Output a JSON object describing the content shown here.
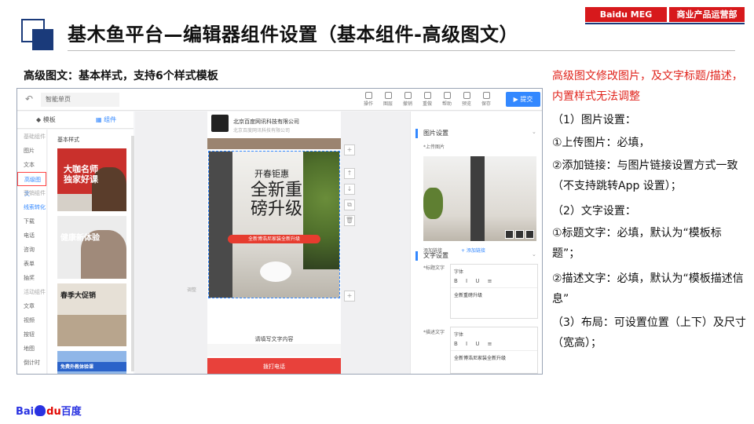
{
  "slide": {
    "title": "基木鱼平台—编辑器组件设置（基本组件-高级图文）",
    "badge_left": "Baidu MEG",
    "badge_right": "商业产品运营部",
    "subtitle": "高级图文：基本样式，支持6个样式模板",
    "logo_text_bai": "Bai",
    "logo_text_du": "du",
    "logo_text_cn": "百度"
  },
  "notes": {
    "red": "高级图文修改图片，及文字标题/描述，内置样式无法调整",
    "lines": [
      "（1）图片设置：",
      "①上传图片：必填，",
      "②添加链接：与图片链接设置方式一致（不支持跳转App 设置）；",
      "（2）文字设置：",
      "①标题文字：必填，默认为“模板标题”；",
      "②描述文字：必填，默认为“模板描述信息”",
      "（3）布局：可设置位置（上下）及尺寸（宽高）；"
    ]
  },
  "editor": {
    "page_name": "智能单页",
    "toolbar": [
      "操作",
      "图层",
      "撤销",
      "重做",
      "帮助",
      "预览",
      "保存"
    ],
    "submit": "提交",
    "tabs": {
      "template": "模板",
      "component": "组件"
    },
    "categories": [
      {
        "label": "基础组件",
        "kind": "head"
      },
      {
        "label": "图片",
        "kind": "item"
      },
      {
        "label": "文本",
        "kind": "item"
      },
      {
        "label": "高级图文",
        "kind": "active"
      },
      {
        "label": "营销组件",
        "kind": "head"
      },
      {
        "label": "线索转化",
        "kind": "blue"
      },
      {
        "label": "下载",
        "kind": "item"
      },
      {
        "label": "电话",
        "kind": "item"
      },
      {
        "label": "咨询",
        "kind": "item"
      },
      {
        "label": "表单",
        "kind": "item"
      },
      {
        "label": "抽奖",
        "kind": "item"
      },
      {
        "label": "活动组件",
        "kind": "head"
      },
      {
        "label": "文章",
        "kind": "item"
      },
      {
        "label": "视频",
        "kind": "item"
      },
      {
        "label": "按钮",
        "kind": "item"
      },
      {
        "label": "地图",
        "kind": "item"
      },
      {
        "label": "倒计时",
        "kind": "item"
      },
      {
        "label": "布局组件",
        "kind": "head"
      }
    ],
    "comp_head": "基本样式",
    "templates": [
      {
        "text": "大咖名师\n独家好课",
        "color": "#c9302c"
      },
      {
        "text": "健康新体验",
        "color": "#8a6d5a"
      },
      {
        "text": "春季大促销",
        "color": "#d9d0c4"
      },
      {
        "text": "免费外教体验课",
        "color": "#2b63c9"
      }
    ],
    "phone": {
      "company": "北京百度网讯科技有限公司",
      "company_sub": "北京百度网讯科技有限公司",
      "banner_top": "开春钜惠",
      "banner_main": "全新重磅升级",
      "banner_red": "全新博浩尼家装全新升级",
      "placeholder": "请填写文字内容",
      "call": "拨打电话"
    },
    "zoom_label": "调整",
    "props": {
      "image_section": "图片设置",
      "upload_label": "*上传图片",
      "add_link_label": "添加链接",
      "add_link_action": "+ 添加链接",
      "text_section": "文字设置",
      "title_label": "*标题文字",
      "desc_label": "*描述文字",
      "font_label": "字体",
      "title_value": "全新重磅升级",
      "desc_value": "全新博浩尼家装全新升级"
    }
  }
}
